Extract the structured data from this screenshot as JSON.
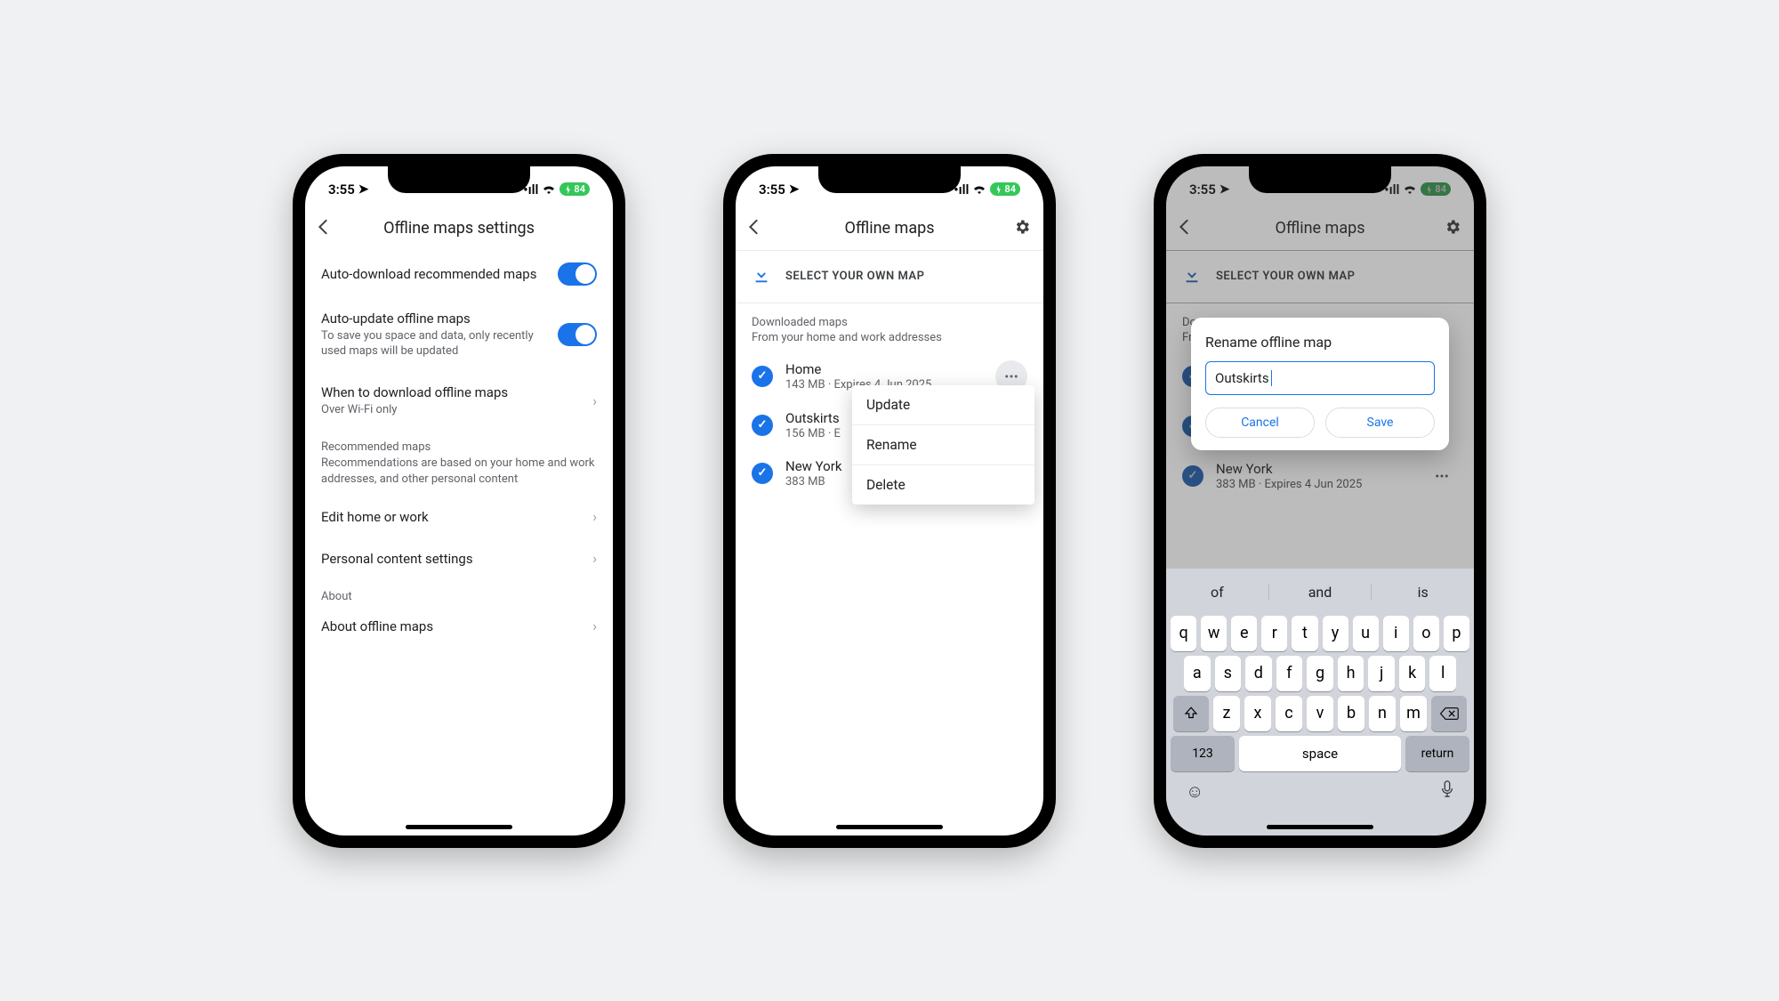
{
  "status": {
    "time": "3:55",
    "battery": "84"
  },
  "phone1": {
    "title": "Offline maps settings",
    "rows": {
      "auto_dl": {
        "title": "Auto-download recommended maps"
      },
      "auto_update": {
        "title": "Auto-update offline maps",
        "sub": "To save you space and data, only recently used maps will be updated"
      },
      "when": {
        "title": "When to download offline maps",
        "sub": "Over Wi-Fi only"
      },
      "rec_header": "Recommended maps",
      "rec_note": "Recommendations are based on your home and work addresses, and other personal content",
      "edit": "Edit home or work",
      "personal": "Personal content settings",
      "about_header": "About",
      "about": "About offline maps"
    }
  },
  "phone2": {
    "title": "Offline maps",
    "select": "SELECT YOUR OWN MAP",
    "group_title": "Downloaded maps",
    "group_sub": "From your home and work addresses",
    "maps": [
      {
        "name": "Home",
        "meta": "143 MB · Expires 4 Jun 2025"
      },
      {
        "name": "Outskirts",
        "meta": "156 MB · E"
      },
      {
        "name": "New York",
        "meta": "383 MB"
      }
    ],
    "menu": {
      "update": "Update",
      "rename": "Rename",
      "delete": "Delete"
    }
  },
  "phone3": {
    "title": "Offline maps",
    "select": "SELECT YOUR OWN MAP",
    "group_title": "Down",
    "group_sub": "From",
    "maps": [
      {
        "name": "",
        "meta": ""
      },
      {
        "name": "",
        "meta": ""
      },
      {
        "name": "New York",
        "meta": "383 MB · Expires 4 Jun 2025"
      }
    ],
    "dialog": {
      "title": "Rename offline map",
      "value": "Outskirts",
      "cancel": "Cancel",
      "save": "Save"
    },
    "keyboard": {
      "suggestions": [
        "of",
        "and",
        "is"
      ],
      "row1": [
        "q",
        "w",
        "e",
        "r",
        "t",
        "y",
        "u",
        "i",
        "o",
        "p"
      ],
      "row2": [
        "a",
        "s",
        "d",
        "f",
        "g",
        "h",
        "j",
        "k",
        "l"
      ],
      "row3": [
        "z",
        "x",
        "c",
        "v",
        "b",
        "n",
        "m"
      ],
      "num": "123",
      "space": "space",
      "ret": "return"
    }
  }
}
